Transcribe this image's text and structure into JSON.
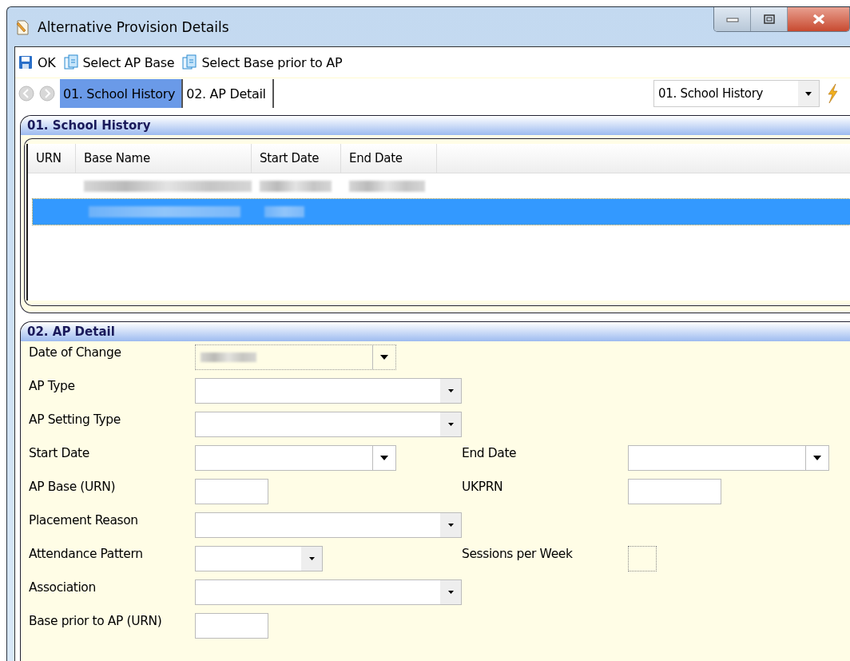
{
  "window": {
    "title": "Alternative Provision Details"
  },
  "toolbar": [
    {
      "label": "OK",
      "kind": "save"
    },
    {
      "label": "Select AP Base",
      "kind": "select"
    },
    {
      "label": "Select Base prior to AP",
      "kind": "select"
    }
  ],
  "tabs": [
    {
      "label": "01. School History",
      "selected": true
    },
    {
      "label": "02. AP Detail",
      "selected": false
    }
  ],
  "section_selector": {
    "value": "01. School History"
  },
  "school_history": {
    "title": "01. School History",
    "columns": [
      "URN",
      "Base Name",
      "Start Date",
      "End Date"
    ],
    "rows": [
      {
        "selected": false
      },
      {
        "selected": true
      }
    ]
  },
  "ap_detail": {
    "title": "02. AP Detail",
    "rows": [
      [
        {
          "label": "Date of Change",
          "kind": "date"
        }
      ],
      [
        {
          "label": "AP Type",
          "kind": "combo"
        }
      ],
      [
        {
          "label": "AP Setting Type",
          "kind": "combo"
        }
      ],
      [
        {
          "label": "Start Date",
          "kind": "date"
        },
        {
          "label": "End Date",
          "kind": "date"
        }
      ],
      [
        {
          "label": "AP Base (URN)",
          "kind": "text"
        },
        {
          "label": "UKPRN",
          "kind": "text"
        }
      ],
      [
        {
          "label": "Placement Reason",
          "kind": "combo"
        }
      ],
      [
        {
          "label": "Attendance Pattern",
          "kind": "combo"
        },
        {
          "label": "Sessions per Week",
          "kind": "spin"
        }
      ],
      [
        {
          "label": "Association",
          "kind": "combo"
        }
      ],
      [
        {
          "label": "Base prior to AP (URN)",
          "kind": "text"
        }
      ]
    ]
  }
}
